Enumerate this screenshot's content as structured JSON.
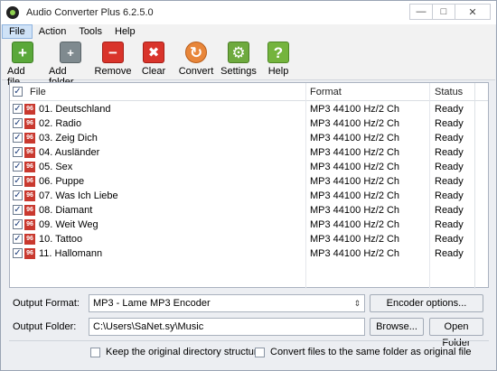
{
  "window": {
    "title": "Audio Converter Plus 6.2.5.0",
    "controls": [
      "—",
      "□",
      "✕"
    ]
  },
  "menu": [
    "File",
    "Action",
    "Tools",
    "Help"
  ],
  "toolbar": [
    {
      "label": "Add file",
      "icon": "plus",
      "glyph": "+"
    },
    {
      "label": "Add folder",
      "icon": "folder-plus",
      "glyph": "+"
    },
    {
      "label": "Remove",
      "icon": "minus",
      "glyph": "−"
    },
    {
      "label": "Clear",
      "icon": "x",
      "glyph": "✖"
    },
    {
      "label": "Convert",
      "icon": "convert",
      "glyph": "↻"
    },
    {
      "label": "Settings",
      "icon": "gear",
      "glyph": "⚙"
    },
    {
      "label": "Help",
      "icon": "question",
      "glyph": "?"
    }
  ],
  "list": {
    "columns": [
      "File",
      "Format",
      "Status"
    ],
    "file_icon_text": "96",
    "check_glyph": "✓",
    "rows": [
      {
        "file": "01. Deutschland",
        "format": "MP3 44100 Hz/2 Ch",
        "status": "Ready"
      },
      {
        "file": "02. Radio",
        "format": "MP3 44100 Hz/2 Ch",
        "status": "Ready"
      },
      {
        "file": "03. Zeig Dich",
        "format": "MP3 44100 Hz/2 Ch",
        "status": "Ready"
      },
      {
        "file": "04. Ausländer",
        "format": "MP3 44100 Hz/2 Ch",
        "status": "Ready"
      },
      {
        "file": "05. Sex",
        "format": "MP3 44100 Hz/2 Ch",
        "status": "Ready"
      },
      {
        "file": "06. Puppe",
        "format": "MP3 44100 Hz/2 Ch",
        "status": "Ready"
      },
      {
        "file": "07. Was Ich Liebe",
        "format": "MP3 44100 Hz/2 Ch",
        "status": "Ready"
      },
      {
        "file": "08. Diamant",
        "format": "MP3 44100 Hz/2 Ch",
        "status": "Ready"
      },
      {
        "file": "09. Weit Weg",
        "format": "MP3 44100 Hz/2 Ch",
        "status": "Ready"
      },
      {
        "file": "10. Tattoo",
        "format": "MP3 44100 Hz/2 Ch",
        "status": "Ready"
      },
      {
        "file": "11. Hallomann",
        "format": "MP3 44100 Hz/2 Ch",
        "status": "Ready"
      }
    ]
  },
  "output": {
    "format_label": "Output Format:",
    "format_value": "MP3  - Lame MP3 Encoder",
    "encoder_button": "Encoder options...",
    "folder_label": "Output Folder:",
    "folder_value": "C:\\Users\\SaNet.sy\\Music",
    "browse_button": "Browse...",
    "open_folder_button": "Open Folder",
    "keep_structure": "Keep the original directory structure",
    "same_folder": "Convert files to the same folder as original file"
  }
}
